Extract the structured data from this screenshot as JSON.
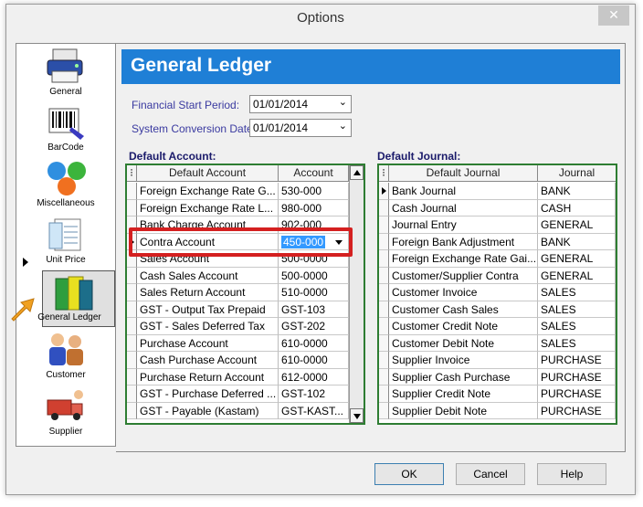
{
  "window": {
    "title": "Options",
    "close_symbol": "✕"
  },
  "sidebar": {
    "items": [
      {
        "label": "General",
        "icon": "printer-icon"
      },
      {
        "label": "BarCode",
        "icon": "barcode-scanner-icon"
      },
      {
        "label": "Miscellaneous",
        "icon": "colored-balls-icon"
      },
      {
        "label": "Unit Price",
        "icon": "price-list-icon"
      },
      {
        "label": "General Ledger",
        "icon": "ledger-books-icon"
      },
      {
        "label": "Customer",
        "icon": "customer-people-icon"
      },
      {
        "label": "Supplier",
        "icon": "delivery-truck-icon"
      }
    ],
    "selected_index": 4
  },
  "header": {
    "title": "General Ledger",
    "color": "#1f7fd6"
  },
  "fields": {
    "financial_start_label": "Financial Start Period:",
    "financial_start_value": "01/01/2014",
    "conversion_date_label": "System Conversion Date:",
    "conversion_date_value": "01/01/2014"
  },
  "default_account": {
    "section_label": "Default Account:",
    "columns": [
      "Default Account",
      "Account"
    ],
    "rows": [
      [
        "Foreign Exchange Rate G...",
        "530-000"
      ],
      [
        "Foreign Exchange Rate L...",
        "980-000"
      ],
      [
        "Bank Charge Account",
        "902-000"
      ],
      [
        "Contra Account",
        "450-000"
      ],
      [
        "Sales Account",
        "500-0000"
      ],
      [
        "Cash Sales Account",
        "500-0000"
      ],
      [
        "Sales Return Account",
        "510-0000"
      ],
      [
        "GST - Output Tax Prepaid",
        "GST-103"
      ],
      [
        "GST - Sales Deferred Tax",
        "GST-202"
      ],
      [
        "Purchase Account",
        "610-0000"
      ],
      [
        "Cash Purchase Account",
        "610-0000"
      ],
      [
        "Purchase Return Account",
        "612-0000"
      ],
      [
        "GST - Purchase Deferred ...",
        "GST-102"
      ],
      [
        "GST - Payable (Kastam)",
        "GST-KAST..."
      ]
    ],
    "current_row": 3
  },
  "default_journal": {
    "section_label": "Default Journal:",
    "columns": [
      "Default Journal",
      "Journal"
    ],
    "rows": [
      [
        "Bank Journal",
        "BANK"
      ],
      [
        "Cash Journal",
        "CASH"
      ],
      [
        "Journal Entry",
        "GENERAL"
      ],
      [
        "Foreign Bank Adjustment",
        "BANK"
      ],
      [
        "Foreign Exchange Rate Gai...",
        "GENERAL"
      ],
      [
        "Customer/Supplier Contra",
        "GENERAL"
      ],
      [
        "Customer Invoice",
        "SALES"
      ],
      [
        "Customer Cash Sales",
        "SALES"
      ],
      [
        "Customer Credit Note",
        "SALES"
      ],
      [
        "Customer Debit Note",
        "SALES"
      ],
      [
        "Supplier Invoice",
        "PURCHASE"
      ],
      [
        "Supplier Cash Purchase",
        "PURCHASE"
      ],
      [
        "Supplier Credit Note",
        "PURCHASE"
      ],
      [
        "Supplier Debit Note",
        "PURCHASE"
      ]
    ],
    "current_row": 0
  },
  "buttons": {
    "ok": "OK",
    "cancel": "Cancel",
    "help": "Help"
  },
  "colors": {
    "grid_border": "#2e7d32",
    "highlight": "#d42020",
    "pointer_arrow": "#f0a020"
  }
}
